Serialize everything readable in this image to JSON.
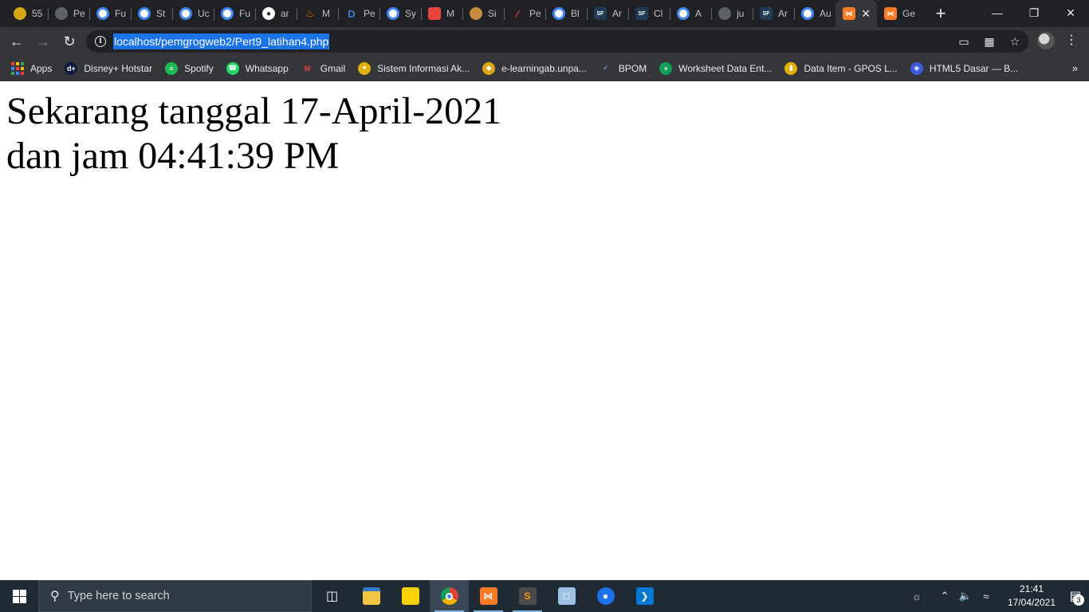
{
  "browser": {
    "tabs": [
      {
        "label": "55",
        "icon": "gold-badge-icon",
        "active": false
      },
      {
        "label": "Pe",
        "icon": "globe-icon",
        "active": false
      },
      {
        "label": "Fu",
        "icon": "google-icon",
        "active": false
      },
      {
        "label": "St",
        "icon": "google-icon",
        "active": false
      },
      {
        "label": "Uc",
        "icon": "google-icon",
        "active": false
      },
      {
        "label": "Fu",
        "icon": "google-icon",
        "active": false
      },
      {
        "label": "ar",
        "icon": "github-icon",
        "active": false
      },
      {
        "label": "M",
        "icon": "java-icon",
        "active": false
      },
      {
        "label": "Pe",
        "icon": "d-letter-icon",
        "active": false
      },
      {
        "label": "Sy",
        "icon": "google-icon",
        "active": false
      },
      {
        "label": "M",
        "icon": "colorful-square-icon",
        "active": false
      },
      {
        "label": "Si",
        "icon": "hat-icon",
        "active": false
      },
      {
        "label": "Pe",
        "icon": "pen-icon",
        "active": false
      },
      {
        "label": "Bl",
        "icon": "google-icon",
        "active": false
      },
      {
        "label": "Ar",
        "icon": "sf-icon",
        "active": false
      },
      {
        "label": "Cl",
        "icon": "sf-icon",
        "active": false
      },
      {
        "label": "A",
        "icon": "google-icon",
        "active": false
      },
      {
        "label": "ju",
        "icon": "globe-icon",
        "active": false
      },
      {
        "label": "Ar",
        "icon": "sf-icon",
        "active": false
      },
      {
        "label": "Au",
        "icon": "google-icon",
        "active": false
      },
      {
        "label": "",
        "icon": "xampp-icon",
        "active": true
      },
      {
        "label": "Ge",
        "icon": "xampp-icon",
        "active": false
      }
    ],
    "url": "localhost/pemgrogweb2/Pert9_latihan4.php",
    "bookmarks": [
      {
        "label": "Apps",
        "icon": "apps-grid-icon"
      },
      {
        "label": "Disney+ Hotstar",
        "icon": "hotstar-icon"
      },
      {
        "label": "Spotify",
        "icon": "spotify-icon"
      },
      {
        "label": "Whatsapp",
        "icon": "whatsapp-icon"
      },
      {
        "label": "Gmail",
        "icon": "gmail-icon"
      },
      {
        "label": "Sistem Informasi Ak...",
        "icon": "sia-icon"
      },
      {
        "label": "e-learningab.unpa...",
        "icon": "elearning-icon"
      },
      {
        "label": "BPOM",
        "icon": "bpom-icon"
      },
      {
        "label": "Worksheet Data Ent...",
        "icon": "sheets-icon"
      },
      {
        "label": "Data Item - GPOS L...",
        "icon": "gpos-icon"
      },
      {
        "label": "HTML5 Dasar — B...",
        "icon": "html5-icon"
      }
    ],
    "bookmarks_more": "»"
  },
  "page": {
    "line1": "Sekarang tanggal 17-April-2021",
    "line2": "dan jam 04:41:39 PM"
  },
  "taskbar": {
    "search_placeholder": "Type here to search",
    "time": "21:41",
    "date": "17/04/2021",
    "notification_count": "3"
  },
  "colors": {
    "chrome_dark": "#202124",
    "toolbar": "#35363a",
    "url_highlight": "#1a73e8",
    "taskbar": "#202a35"
  }
}
